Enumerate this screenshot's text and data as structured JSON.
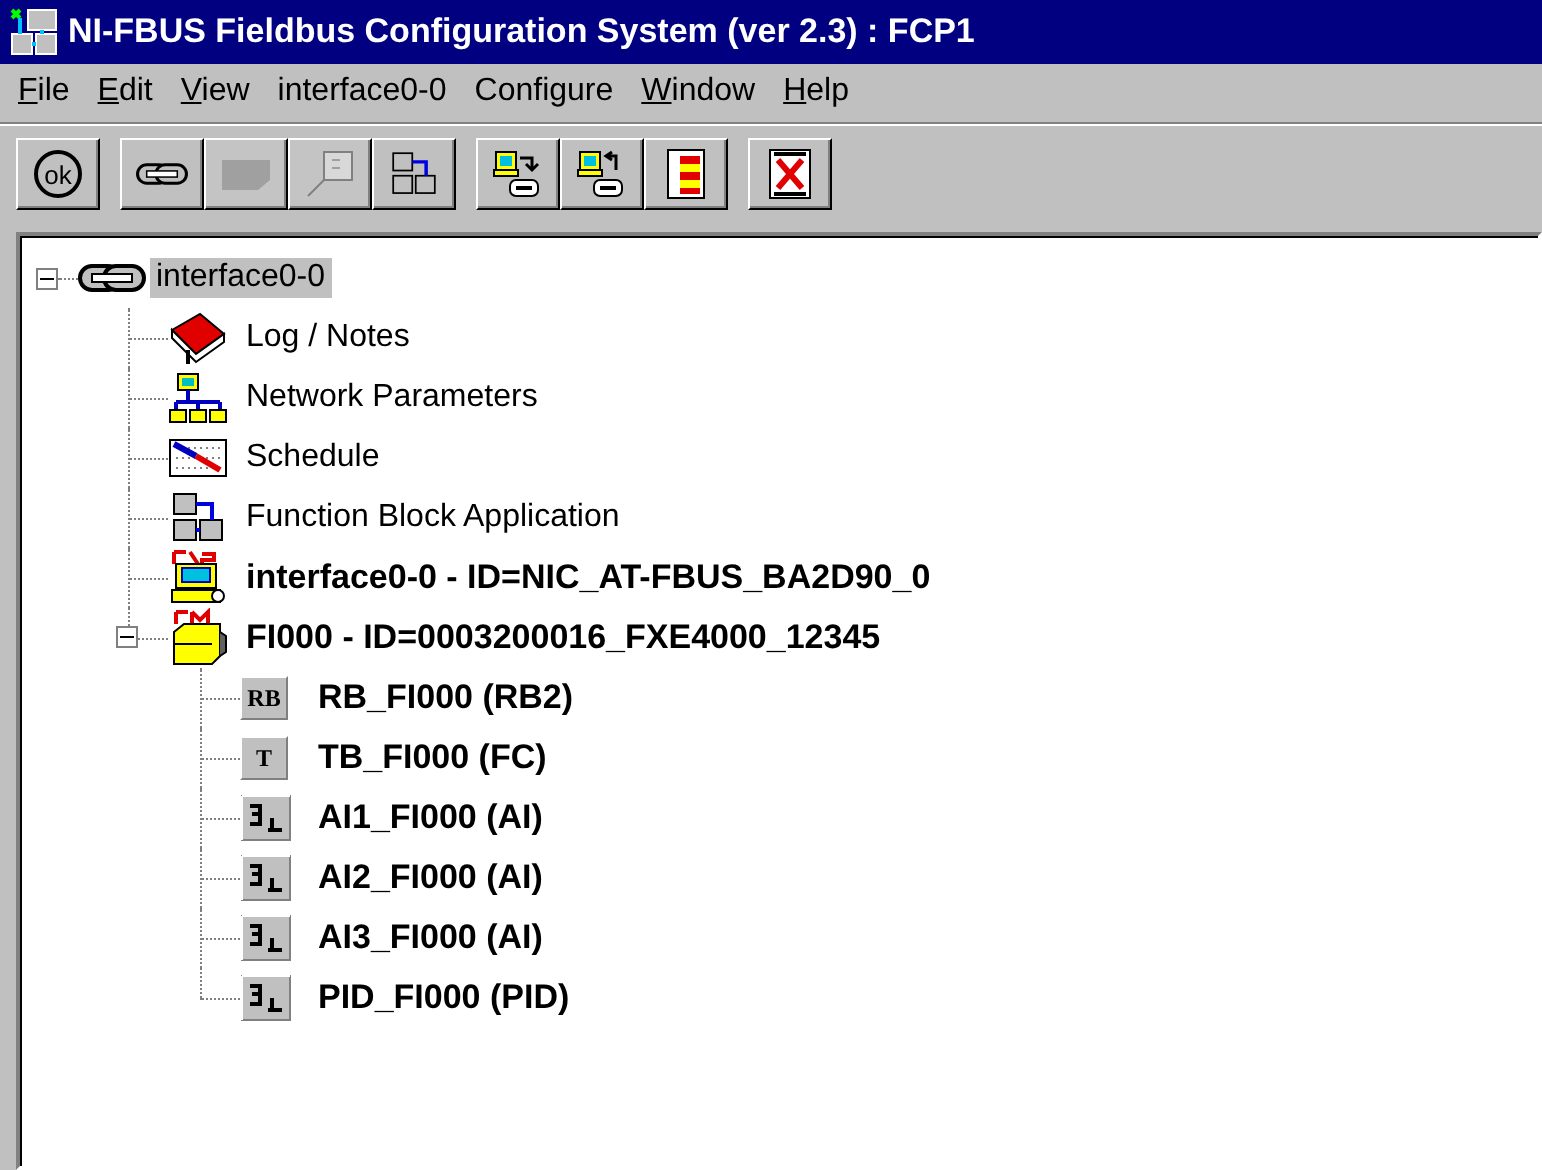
{
  "window": {
    "title": "NI-FBUS Fieldbus Configuration System (ver 2.3) : FCP1"
  },
  "menu": [
    {
      "label": "File",
      "underline_first": true
    },
    {
      "label": "Edit",
      "underline_first": true
    },
    {
      "label": "View",
      "underline_first": true
    },
    {
      "label": "interface0-0",
      "underline_first": false
    },
    {
      "label": "Configure",
      "underline_first": false
    },
    {
      "label": "Window",
      "underline_first": true
    },
    {
      "label": "Help",
      "underline_first": true
    }
  ],
  "toolbar": {
    "groups": [
      {
        "buttons": [
          {
            "kind": "ok",
            "label": "ok",
            "disabled": false
          }
        ]
      },
      {
        "buttons": [
          {
            "kind": "link",
            "disabled": false
          },
          {
            "kind": "blank",
            "disabled": true
          },
          {
            "kind": "popup",
            "disabled": true
          },
          {
            "kind": "fba",
            "disabled": false
          }
        ]
      },
      {
        "buttons": [
          {
            "kind": "download",
            "disabled": false
          },
          {
            "kind": "upload",
            "disabled": false
          },
          {
            "kind": "list",
            "disabled": false
          }
        ]
      },
      {
        "buttons": [
          {
            "kind": "cancel",
            "disabled": false
          }
        ]
      }
    ]
  },
  "tree": {
    "items": [
      {
        "label": "interface0-0",
        "kind": "link",
        "bold": false,
        "selected": true,
        "expanded": true,
        "children": [
          {
            "label": "Log / Notes",
            "kind": "book",
            "bold": false,
            "selected": false
          },
          {
            "label": "Network Parameters",
            "kind": "network",
            "bold": false,
            "selected": false
          },
          {
            "label": "Schedule",
            "kind": "schedule",
            "bold": false,
            "selected": false
          },
          {
            "label": "Function Block Application",
            "kind": "fba",
            "bold": false,
            "selected": false
          },
          {
            "label": "interface0-0 - ID=NIC_AT-FBUS_BA2D90_0",
            "kind": "las",
            "bold": true,
            "selected": false
          },
          {
            "label": "FI000 - ID=0003200016_FXE4000_12345",
            "kind": "device",
            "bold": true,
            "selected": false,
            "expanded": true,
            "children": [
              {
                "label": "RB_FI000 (RB2)",
                "kind": "tag",
                "tag": "RB",
                "bold": true,
                "selected": false
              },
              {
                "label": "TB_FI000 (FC)",
                "kind": "tag",
                "tag": "T",
                "bold": true,
                "selected": false
              },
              {
                "label": "AI1_FI000 (AI)",
                "kind": "block",
                "bold": true,
                "selected": false
              },
              {
                "label": "AI2_FI000 (AI)",
                "kind": "block",
                "bold": true,
                "selected": false
              },
              {
                "label": "AI3_FI000 (AI)",
                "kind": "block",
                "bold": true,
                "selected": false
              },
              {
                "label": "PID_FI000 (PID)",
                "kind": "block",
                "bold": true,
                "selected": false
              }
            ]
          }
        ]
      }
    ]
  }
}
